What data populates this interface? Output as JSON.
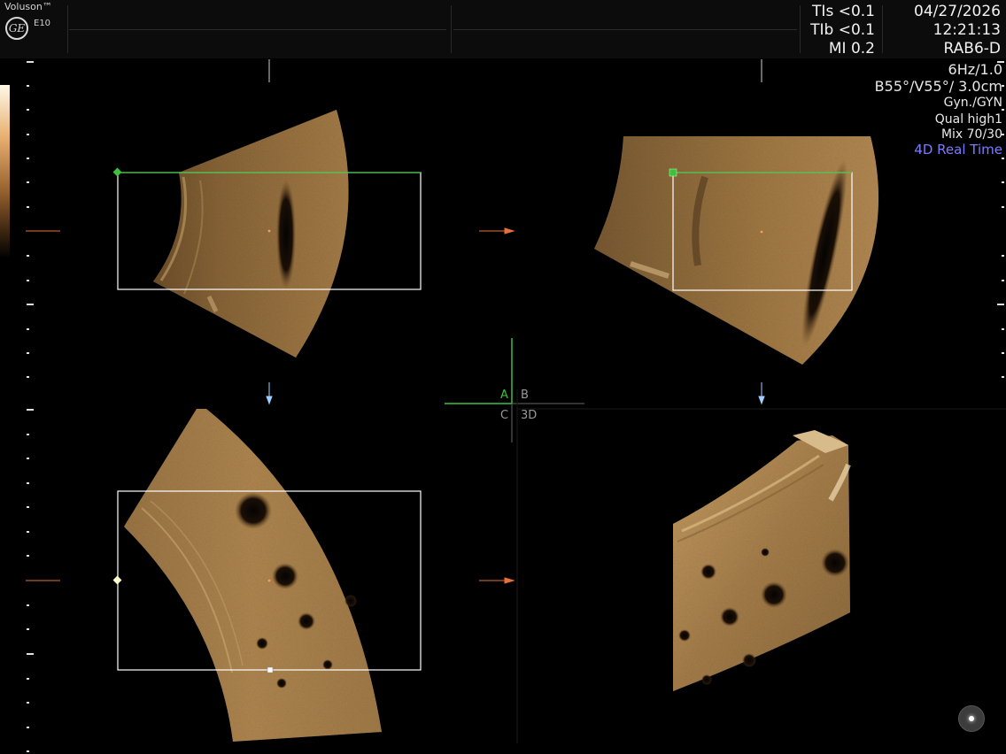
{
  "header": {
    "brand": "Voluson™",
    "logo_text": "GE",
    "model": "E10",
    "indices": [
      "TIs <0.1",
      "TIb <0.1",
      "MI  0.2"
    ],
    "date": "04/27/2026",
    "time": "12:21:13",
    "probe": "RAB6-D"
  },
  "params": [
    "6Hz/1.0",
    "B55°/V55°/ 3.0cm",
    "Gyn./GYN",
    "Qual high1",
    "Mix 70/30",
    "4D Real Time"
  ],
  "quad_labels": {
    "a": "A",
    "b": "B",
    "c": "C",
    "d": "3D"
  },
  "colors": {
    "tissue": "#b28a52",
    "roi_box": "#ffffff",
    "roi_active": "#3fbf3f",
    "arrow": "#e8703a",
    "live": "#7c7cff"
  },
  "icons": {
    "probe_state": "probe-indicator-icon",
    "depth_marker": "depth-marker-icon"
  }
}
